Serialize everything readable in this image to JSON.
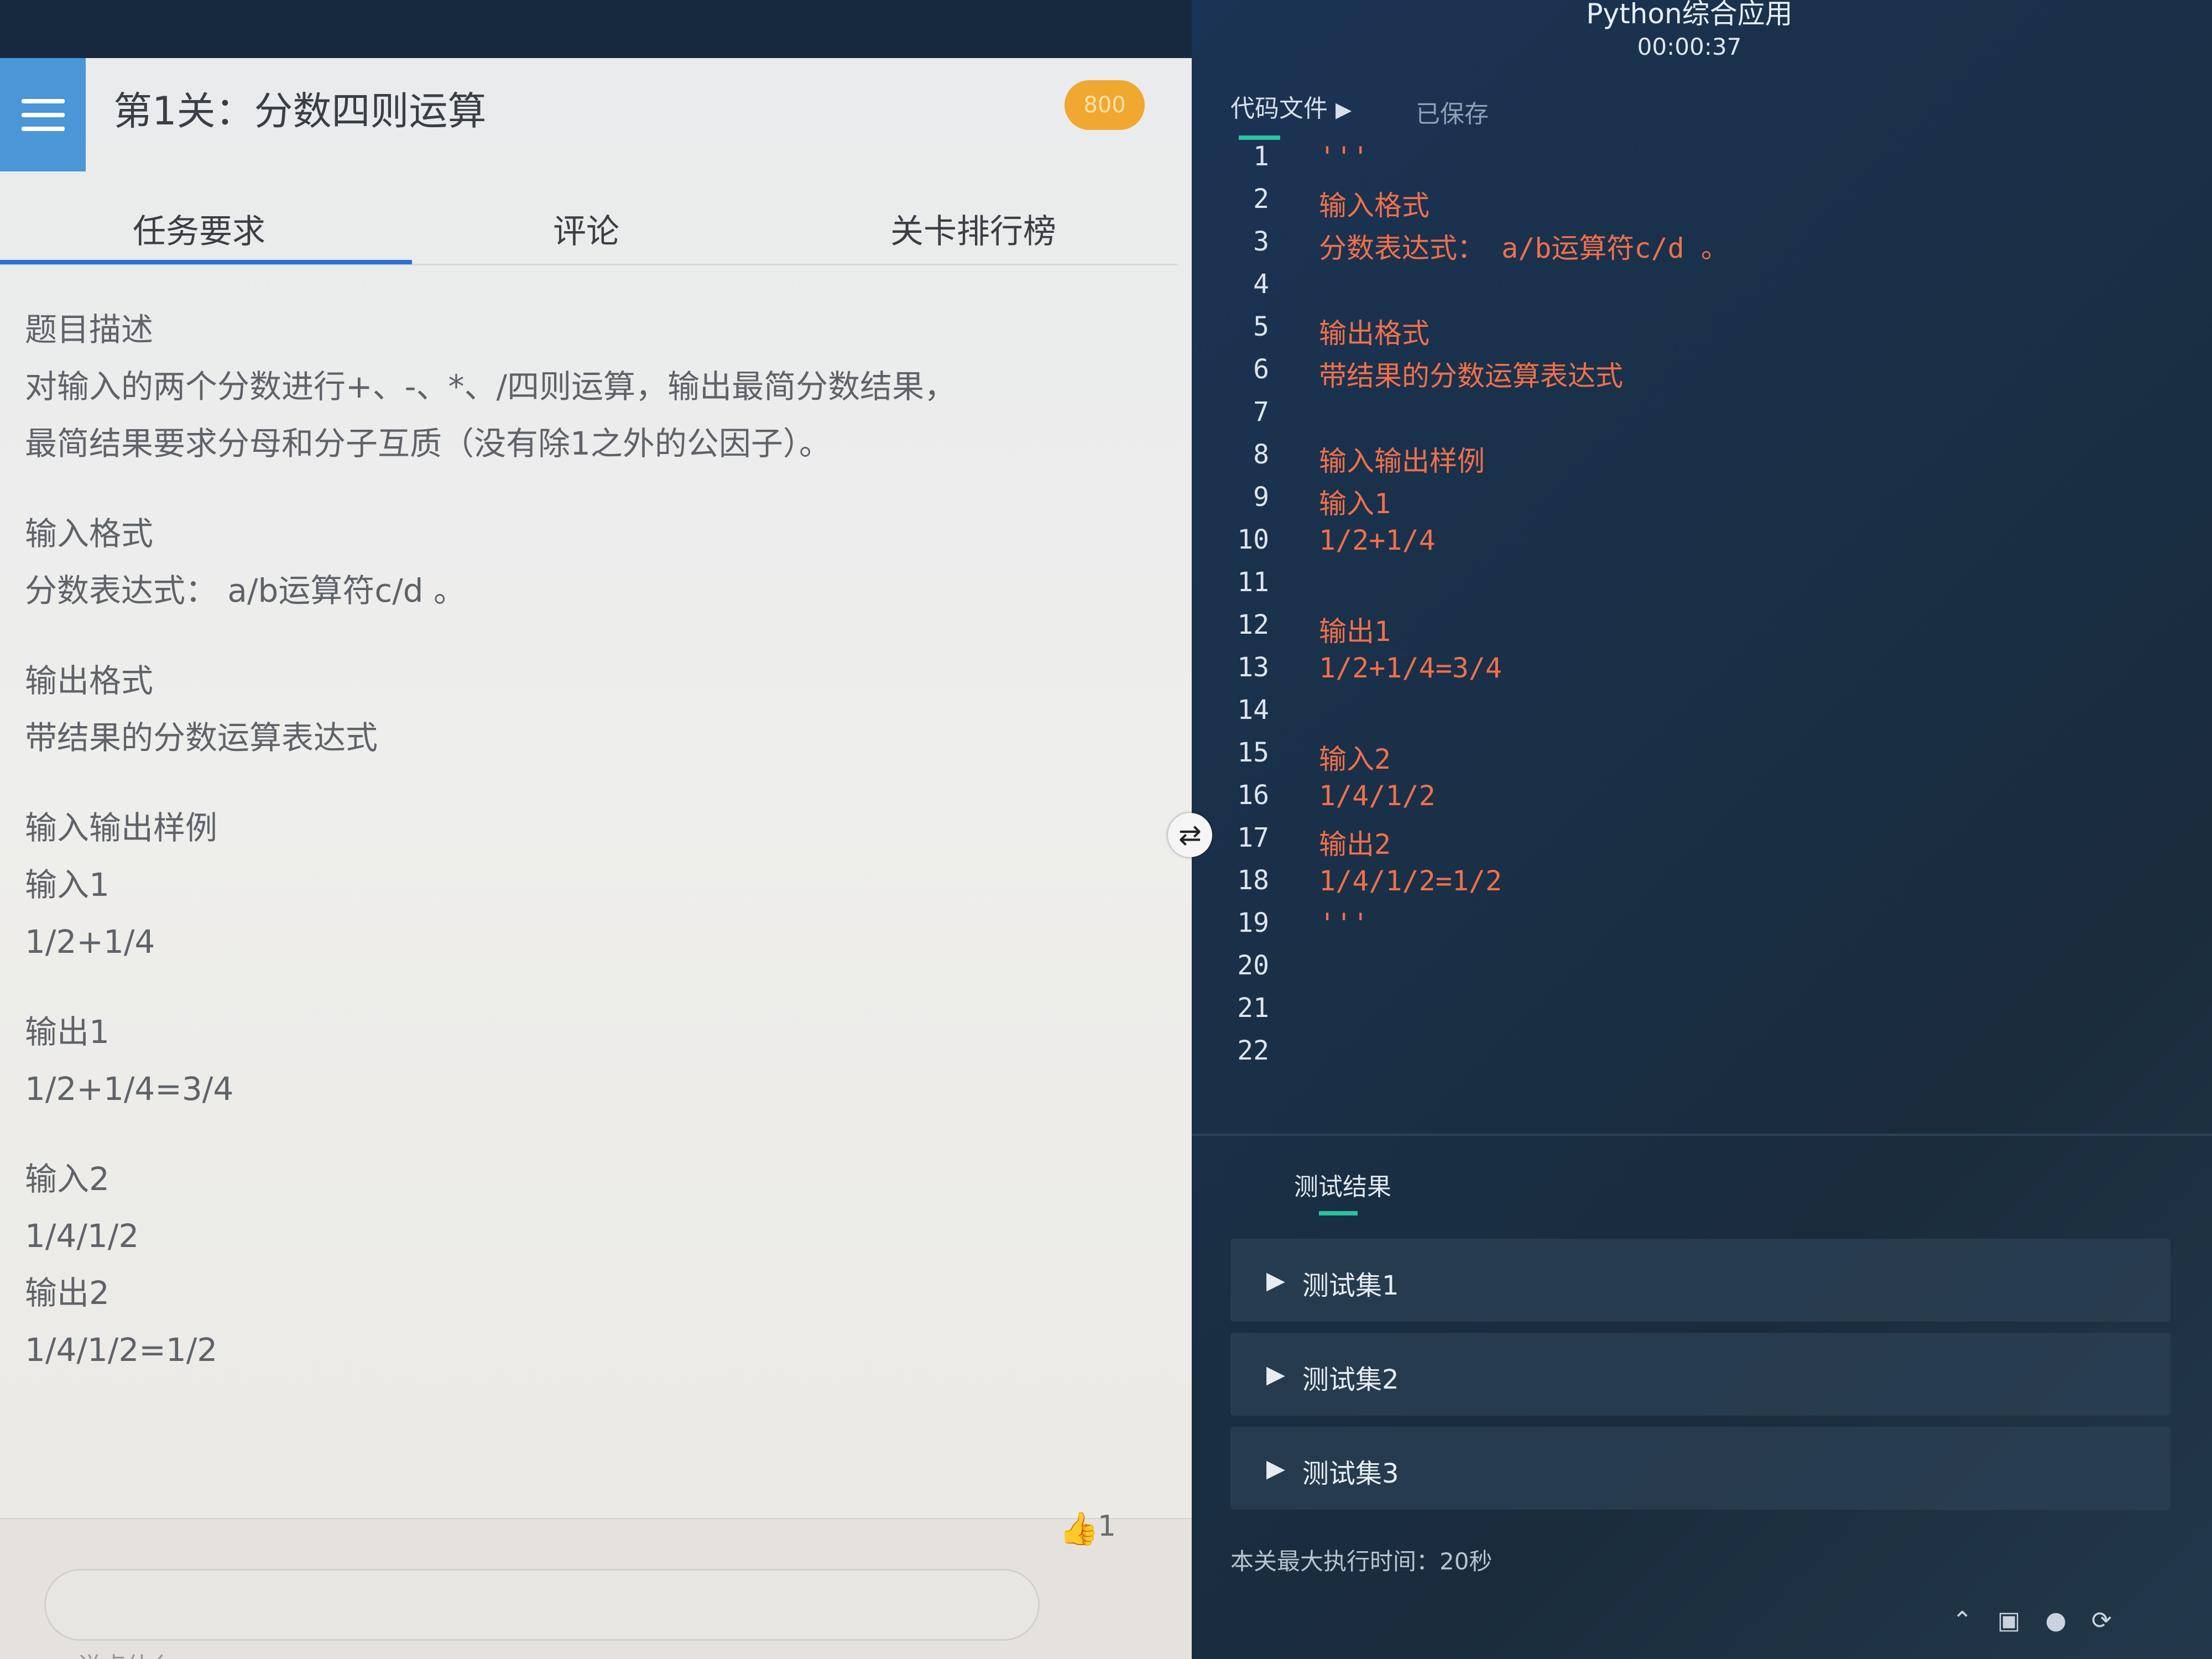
{
  "app": {
    "title": "Python综合应用",
    "timer": "00:00:37"
  },
  "left": {
    "level_title": "第1关：分数四则运算",
    "score_badge": "800",
    "tabs": [
      {
        "label": "任务要求"
      },
      {
        "label": "评论"
      },
      {
        "label": "关卡排行榜"
      }
    ],
    "content": {
      "desc_heading": "题目描述",
      "desc_line1": "对输入的两个分数进行+、-、*、/四则运算，输出最简分数结果，",
      "desc_line2": "最简结果要求分母和分子互质（没有除1之外的公因子）。",
      "input_heading": "输入格式",
      "input_text": "分数表达式： a/b运算符c/d 。",
      "output_heading": "输出格式",
      "output_text": "带结果的分数运算表达式",
      "sample_heading": "输入输出样例",
      "in1_label": "输入1",
      "in1_value": "1/2+1/4",
      "out1_label": "输出1",
      "out1_value": "1/2+1/4=3/4",
      "in2_label": "输入2",
      "in2_value": "1/4/1/2",
      "out2_label": "输出2",
      "out2_value": "1/4/1/2=1/2"
    },
    "comment_placeholder": "说点什么",
    "like_count": "1"
  },
  "editor": {
    "file_tab": "代码文件",
    "saved_label": "已保存",
    "lines": [
      {
        "n": "1",
        "code": "'''"
      },
      {
        "n": "2",
        "code": "输入格式"
      },
      {
        "n": "3",
        "code": "分数表达式： a/b运算符c/d 。"
      },
      {
        "n": "4",
        "code": ""
      },
      {
        "n": "5",
        "code": "输出格式"
      },
      {
        "n": "6",
        "code": "带结果的分数运算表达式"
      },
      {
        "n": "7",
        "code": ""
      },
      {
        "n": "8",
        "code": "输入输出样例"
      },
      {
        "n": "9",
        "code": "输入1"
      },
      {
        "n": "10",
        "code": "1/2+1/4"
      },
      {
        "n": "11",
        "code": ""
      },
      {
        "n": "12",
        "code": "输出1"
      },
      {
        "n": "13",
        "code": "1/2+1/4=3/4"
      },
      {
        "n": "14",
        "code": ""
      },
      {
        "n": "15",
        "code": "输入2"
      },
      {
        "n": "16",
        "code": "1/4/1/2"
      },
      {
        "n": "17",
        "code": "输出2"
      },
      {
        "n": "18",
        "code": "1/4/1/2=1/2"
      },
      {
        "n": "19",
        "code": "'''"
      },
      {
        "n": "20",
        "code": ""
      },
      {
        "n": "21",
        "code": ""
      },
      {
        "n": "22",
        "code": ""
      }
    ]
  },
  "results": {
    "tab_label": "测试结果",
    "test_sets": [
      {
        "label": "测试集1"
      },
      {
        "label": "测试集2"
      },
      {
        "label": "测试集3"
      }
    ],
    "exec_time": "本关最大执行时间：20秒"
  },
  "icons": {
    "menu": "menu-icon",
    "like": "thumbs-up-icon",
    "splitter": "resize-arrows-icon",
    "expand": "triangle-right-icon"
  },
  "colors": {
    "accent_blue": "#4a96d6",
    "badge_orange": "#f0a830",
    "code_text": "#f0704a",
    "tab_active": "#2f6fd4",
    "teal": "#29c2a0"
  }
}
